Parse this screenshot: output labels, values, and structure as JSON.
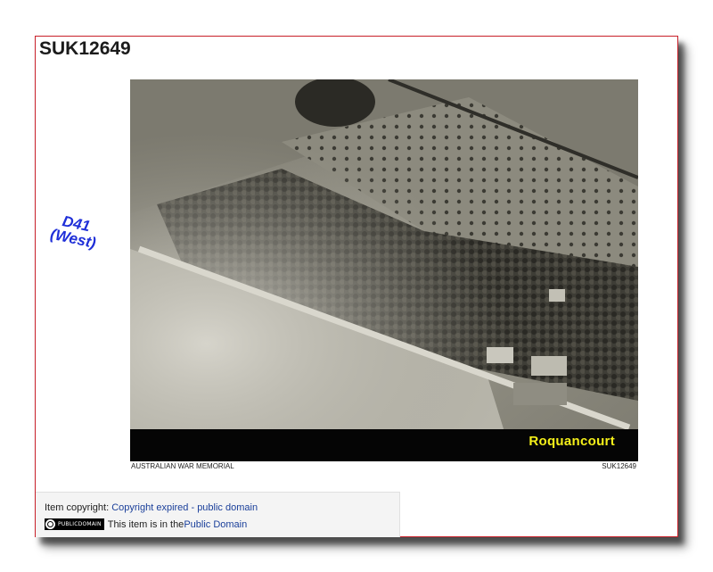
{
  "record": {
    "title": "SUK12649",
    "road_label_line1": "D41",
    "road_label_line2": "(West)",
    "place_label": "Roquancourt",
    "caption_left": "AUSTRALIAN WAR MEMORIAL",
    "caption_right": "SUK12649"
  },
  "copyright": {
    "prefix": "Item copyright: ",
    "link": "Copyright expired - public domain",
    "badge_text": "PUBLICDOMAIN",
    "statement": "This item is in the ",
    "statement_link": "Public Domain"
  },
  "colors": {
    "frame_border": "#c8202a",
    "road_label": "#1f2fd8",
    "place_label": "#f5f01a",
    "link": "#1a3f9a"
  }
}
